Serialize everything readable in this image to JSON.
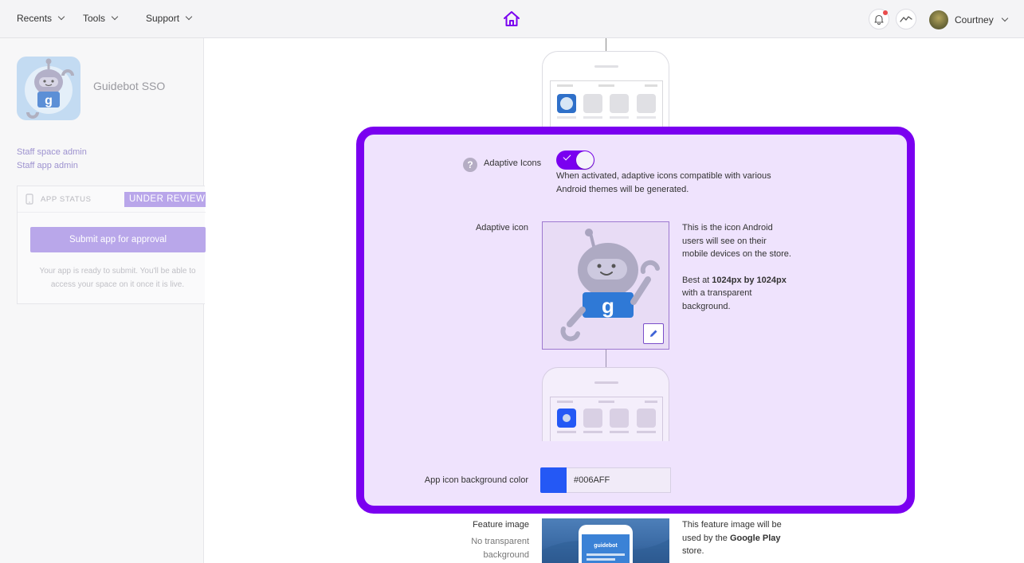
{
  "topbar": {
    "nav": [
      {
        "label": "Recents"
      },
      {
        "label": "Tools"
      },
      {
        "label": "Support"
      }
    ],
    "user_name": "Courtney"
  },
  "sidebar": {
    "app_name": "Guidebot SSO",
    "links": [
      "Staff space admin",
      "Staff app admin"
    ],
    "status_label": "APP STATUS",
    "status_value": "UNDER REVIEW",
    "submit_label": "Submit app for approval",
    "status_note": "Your app is ready to submit. You'll be able to access your space on it once it is live."
  },
  "adaptive": {
    "label": "Adaptive Icons",
    "enabled": true,
    "description": "When activated, adaptive icons compatible with various Android themes will be generated.",
    "icon_label": "Adaptive icon",
    "icon_desc_1": "This is the icon Android users will see on their mobile devices on the store.",
    "icon_desc_2_prefix": "Best at ",
    "icon_desc_2_bold": "1024px by 1024px",
    "icon_desc_2_suffix": " with a transparent background.",
    "bg_color_label": "App icon background color",
    "bg_color_value": "#006AFF",
    "swatch_color": "#2458f5"
  },
  "feature": {
    "label": "Feature image",
    "sublabel_1": "No transparent",
    "sublabel_2": "background",
    "desc_prefix": "This feature image will be used by the ",
    "desc_bold": "Google Play",
    "desc_suffix": " store.",
    "app_title": "guidebot"
  },
  "colors": {
    "accent": "#7a00f0",
    "highlight_bg": "#efe3fd",
    "sidebar_link": "#9d92cf"
  }
}
